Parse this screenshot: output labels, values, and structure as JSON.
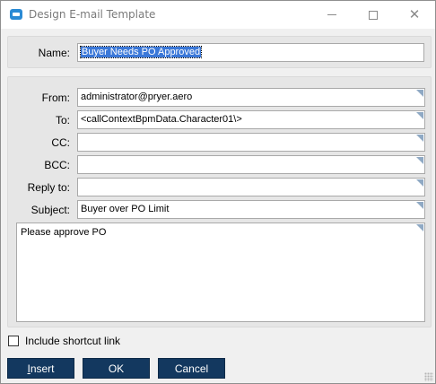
{
  "window": {
    "title": "Design E-mail Template",
    "minimize_glyph": "",
    "close_glyph": "✕"
  },
  "name_field": {
    "label": "Name:",
    "value": "Buyer Needs PO Approved"
  },
  "mail": {
    "from": {
      "label": "From:",
      "value": "administrator@pryer.aero"
    },
    "to": {
      "label": "To:",
      "value": "<callContextBpmData.Character01\\>"
    },
    "cc": {
      "label": "CC:",
      "value": ""
    },
    "bcc": {
      "label": "BCC:",
      "value": ""
    },
    "reply_to": {
      "label": "Reply to:",
      "value": ""
    },
    "subject": {
      "label": "Subject:",
      "value": "Buyer over PO Limit"
    },
    "body": "Please approve PO"
  },
  "options": {
    "include_shortcut_link": {
      "label": "Include shortcut link",
      "checked": false
    }
  },
  "buttons": {
    "insert_accel": "I",
    "insert_rest": "nsert",
    "ok": "OK",
    "cancel": "Cancel"
  },
  "colors": {
    "button_bg": "#13385f",
    "selection": "#3b78d8",
    "panel": "#e6e6e6"
  }
}
